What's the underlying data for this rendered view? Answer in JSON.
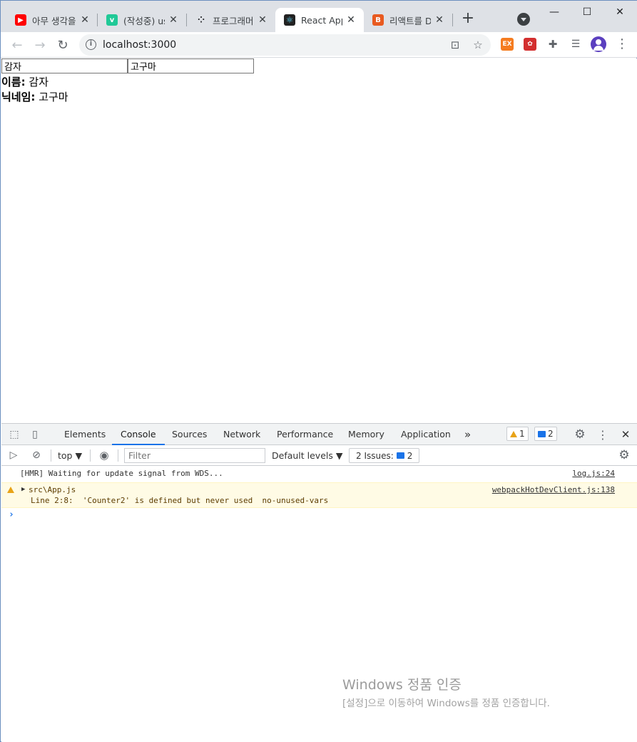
{
  "browser": {
    "tabs": [
      {
        "title": "아무 생각을",
        "favicon": "youtube-icon",
        "color": "#ff0000"
      },
      {
        "title": "(작성중) us",
        "favicon": "velog-icon",
        "color": "#20c997"
      },
      {
        "title": "프로그래머",
        "favicon": "programmers-icon",
        "color": "#202124"
      },
      {
        "title": "React App",
        "favicon": "react-icon",
        "color": "#61dafb",
        "active": true
      },
      {
        "title": "리액트를 D",
        "favicon": "site-icon",
        "color": "#e85a20"
      }
    ],
    "url": "localhost:3000",
    "extensions": [
      "ex-extension-icon",
      "puzzle-extension-icon",
      "extensions-icon",
      "reading-list-icon"
    ]
  },
  "page": {
    "name_input_value": "감자",
    "nickname_input_value": "고구마",
    "name_label": "이름:",
    "name_value": "감자",
    "nickname_label": "닉네임:",
    "nickname_value": "고구마"
  },
  "devtools": {
    "tabs": [
      "Elements",
      "Console",
      "Sources",
      "Network",
      "Performance",
      "Memory",
      "Application"
    ],
    "active_tab": "Console",
    "more_tabs": "»",
    "warning_count": "1",
    "message_count": "2",
    "context": "top",
    "filter_placeholder": "Filter",
    "levels": "Default levels",
    "issues_label": "2 Issues:",
    "issues_count": "2",
    "logs": [
      {
        "type": "info",
        "text": "[HMR] Waiting for update signal from WDS...",
        "source": "log.js:24"
      },
      {
        "type": "warning",
        "text": "src\\App.js",
        "detail": "Line 2:8:  'Counter2' is defined but never used  no-unused-vars",
        "source": "webpackHotDevClient.js:138"
      }
    ],
    "prompt": "›"
  },
  "watermark": {
    "title": "Windows 정품 인증",
    "subtitle": "[설정]으로 이동하여 Windows를 정품 인증합니다."
  }
}
